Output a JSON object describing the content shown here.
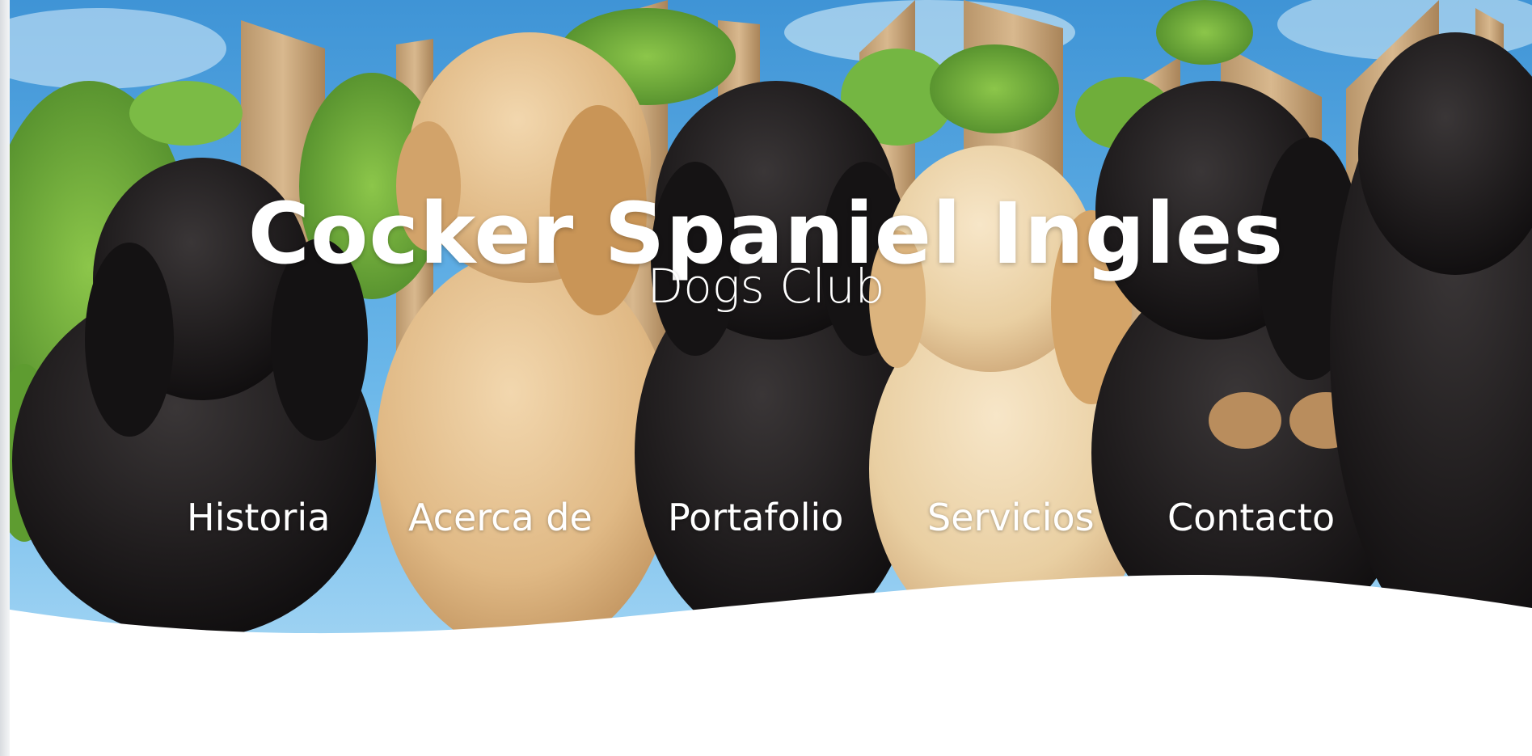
{
  "hero": {
    "title": "Cocker Spaniel Ingles",
    "subtitle": "Dogs Club"
  },
  "nav": {
    "items": [
      {
        "label": "Historia"
      },
      {
        "label": "Acerca de"
      },
      {
        "label": "Portafolio"
      },
      {
        "label": "Servicios"
      },
      {
        "label": "Contacto"
      }
    ]
  },
  "colors": {
    "text": "#ffffff",
    "sky": "#5aa8e0",
    "fence": "#c9a77c",
    "ivy": "#6fae3a",
    "puppy_black": "#1c1a1b",
    "puppy_tan": "#e3bf8c",
    "page_background": "#ffffff"
  }
}
